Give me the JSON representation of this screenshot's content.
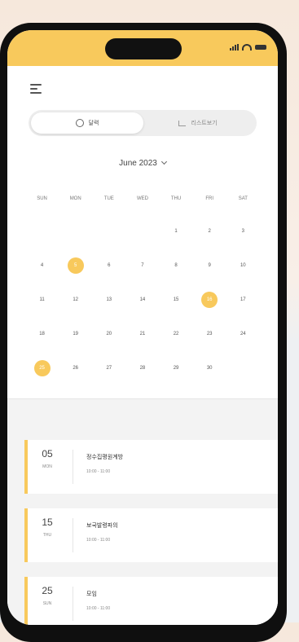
{
  "toggle": {
    "calendar_label": "달력",
    "list_label": "리스트보기"
  },
  "month_selector": {
    "label": "June 2023"
  },
  "weekdays": [
    "SUN",
    "MON",
    "TUE",
    "WED",
    "THU",
    "FRI",
    "SAT"
  ],
  "calendar_weeks": [
    [
      "",
      "",
      "",
      "",
      "1",
      "2",
      "3"
    ],
    [
      "4",
      "5",
      "6",
      "7",
      "8",
      "9",
      "10"
    ],
    [
      "11",
      "12",
      "13",
      "14",
      "15",
      "16",
      "17"
    ],
    [
      "18",
      "19",
      "20",
      "21",
      "22",
      "23",
      "24"
    ],
    [
      "25",
      "26",
      "27",
      "28",
      "29",
      "30",
      ""
    ]
  ],
  "highlighted_days": [
    "5",
    "16",
    "25"
  ],
  "events": [
    {
      "day": "05",
      "weekday": "MON",
      "title": "정수집평원계방",
      "time": "10:00 - 11:00"
    },
    {
      "day": "15",
      "weekday": "THU",
      "title": "보국발령파의",
      "time": "10:00 - 11:00"
    },
    {
      "day": "25",
      "weekday": "SUN",
      "title": "모임",
      "time": "10:00 - 11:00"
    }
  ],
  "colors": {
    "accent": "#f8c95c",
    "phone_frame": "#0f0f0f"
  }
}
